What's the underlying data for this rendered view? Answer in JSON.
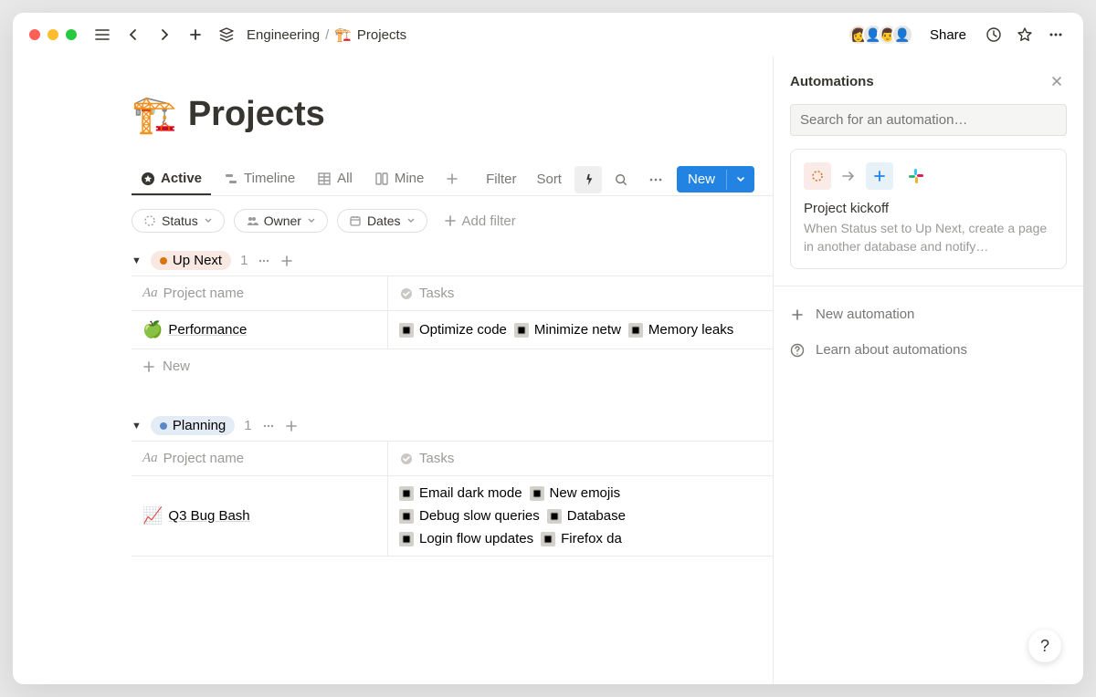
{
  "breadcrumb": {
    "parent": "Engineering",
    "page_icon": "🏗️",
    "page": "Projects"
  },
  "topbar": {
    "share": "Share"
  },
  "page": {
    "icon": "🏗️",
    "title": "Projects"
  },
  "tabs": [
    {
      "label": "Active",
      "active": true
    },
    {
      "label": "Timeline"
    },
    {
      "label": "All"
    },
    {
      "label": "Mine"
    }
  ],
  "toolbar": {
    "filter": "Filter",
    "sort": "Sort",
    "new": "New"
  },
  "filters": {
    "status": "Status",
    "owner": "Owner",
    "dates": "Dates",
    "add": "Add filter"
  },
  "columns": {
    "name": "Project name",
    "tasks": "Tasks"
  },
  "groups": [
    {
      "name": "Up Next",
      "color_bg": "#f8e8e1",
      "dot": "#d9730d",
      "count": "1",
      "rows": [
        {
          "icon": "🍏",
          "name": "Performance",
          "tasks": [
            "Optimize code",
            "Minimize netw",
            "Memory leaks"
          ]
        }
      ],
      "new": "New"
    },
    {
      "name": "Planning",
      "color_bg": "#e3ecf5",
      "dot": "#5a87c7",
      "count": "1",
      "rows": [
        {
          "icon": "📈",
          "name": "Q3 Bug Bash",
          "tasks": [
            "Email dark mode",
            "New emojis",
            "Debug slow queries",
            "Database",
            "Login flow updates",
            "Firefox da"
          ]
        }
      ]
    }
  ],
  "panel": {
    "title": "Automations",
    "search_placeholder": "Search for an automation…",
    "card": {
      "title": "Project kickoff",
      "desc": "When Status set to Up Next, create a page in another database and notify…"
    },
    "new_automation": "New automation",
    "learn": "Learn about automations"
  }
}
